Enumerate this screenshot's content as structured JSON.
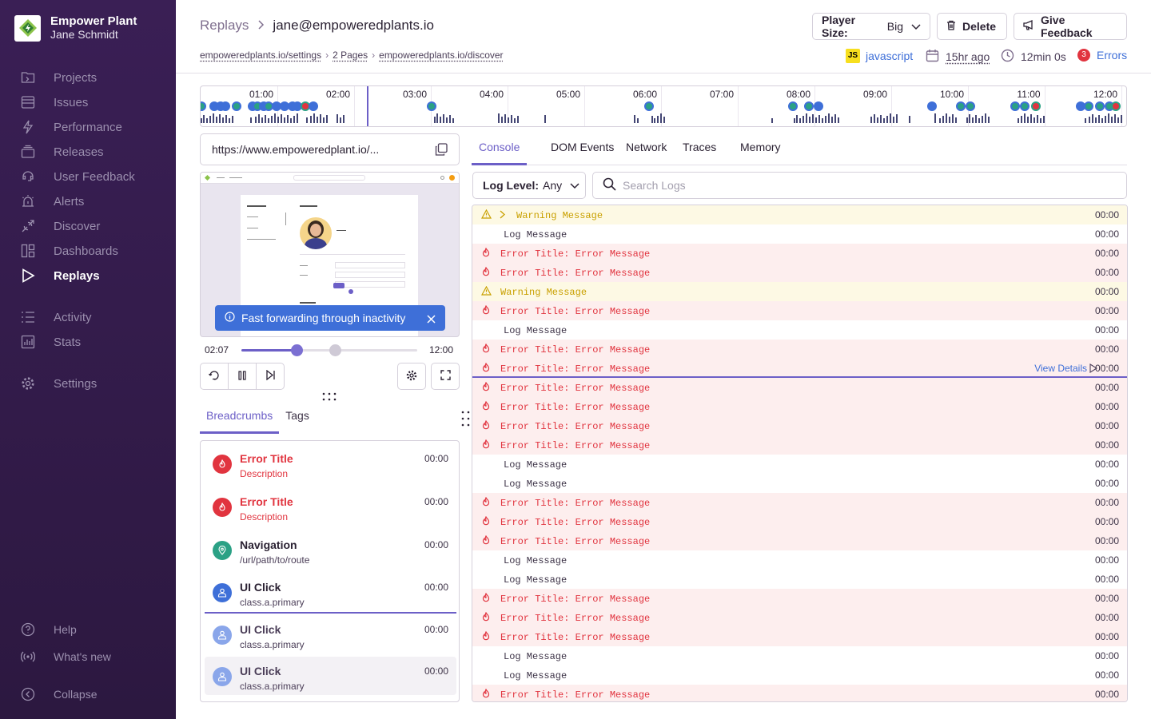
{
  "org": {
    "name": "Empower Plant",
    "user": "Jane Schmidt"
  },
  "sidebar": {
    "items": [
      {
        "label": "Projects",
        "icon": "projects-icon"
      },
      {
        "label": "Issues",
        "icon": "issues-icon"
      },
      {
        "label": "Performance",
        "icon": "performance-icon"
      },
      {
        "label": "Releases",
        "icon": "releases-icon"
      },
      {
        "label": "User Feedback",
        "icon": "user-feedback-icon"
      },
      {
        "label": "Alerts",
        "icon": "alerts-icon"
      },
      {
        "label": "Discover",
        "icon": "discover-icon"
      },
      {
        "label": "Dashboards",
        "icon": "dashboards-icon"
      },
      {
        "label": "Replays",
        "icon": "replays-icon",
        "active": true
      },
      {
        "label": "Activity",
        "icon": "activity-icon"
      },
      {
        "label": "Stats",
        "icon": "stats-icon"
      },
      {
        "label": "Settings",
        "icon": "settings-icon"
      }
    ],
    "footer": [
      {
        "label": "Help",
        "icon": "help-icon"
      },
      {
        "label": "What's new",
        "icon": "broadcast-icon"
      },
      {
        "label": "Collapse",
        "icon": "collapse-icon"
      }
    ]
  },
  "header": {
    "breadcrumb_parent": "Replays",
    "breadcrumb_current": "jane@empoweredplants.io",
    "url_trail": [
      "empoweredplants.io/settings",
      "2 Pages",
      "empoweredplants.io/discover"
    ],
    "player_size_label": "Player Size:",
    "player_size_value": "Big",
    "delete_label": "Delete",
    "feedback_label": "Give Feedback",
    "platform_badge": "JS",
    "platform": "javascript",
    "time_ago": "15hr ago",
    "duration": "12min 0s",
    "error_count": "3",
    "errors_label": "Errors"
  },
  "timeline": {
    "labels": [
      "01:00",
      "02:00",
      "03:00",
      "04:00",
      "05:00",
      "06:00",
      "07:00",
      "08:00",
      "09:00",
      "10:00",
      "11:00",
      "12:00"
    ]
  },
  "player": {
    "url": "https://www.empoweredplant.io/...",
    "toast": "Fast forwarding through inactivity",
    "current_time": "02:07",
    "total_time": "12:00",
    "progress": 0.18
  },
  "left_tabs": [
    "Breadcrumbs",
    "Tags"
  ],
  "breadcrumbs": [
    {
      "title": "Error Title",
      "desc": "Description",
      "time": "00:00",
      "kind": "error"
    },
    {
      "title": "Error Title",
      "desc": "Description",
      "time": "00:00",
      "kind": "error"
    },
    {
      "title": "Navigation",
      "desc": "/url/path/to/route",
      "time": "00:00",
      "kind": "nav"
    },
    {
      "title": "UI Click",
      "desc": "class.a.primary",
      "time": "00:00",
      "kind": "click"
    },
    {
      "title": "UI Click",
      "desc": "class.a.primary",
      "time": "00:00",
      "kind": "click-future"
    },
    {
      "title": "UI Click",
      "desc": "class.a.primary",
      "time": "00:00",
      "kind": "click-hover"
    }
  ],
  "right_tabs": [
    "Console",
    "DOM Events",
    "Network",
    "Traces",
    "Memory"
  ],
  "console": {
    "log_level_label": "Log Level:",
    "log_level_value": "Any",
    "search_placeholder": "Search Logs",
    "view_details": "View Details",
    "rows": [
      {
        "type": "warning",
        "text": "Warning Message",
        "time": "00:00",
        "expandable": true
      },
      {
        "type": "log",
        "text": "Log Message",
        "time": "00:00"
      },
      {
        "type": "error",
        "text": "Error Title: Error Message",
        "time": "00:00"
      },
      {
        "type": "error",
        "text": "Error Title: Error Message",
        "time": "00:00"
      },
      {
        "type": "warning",
        "text": "Warning Message",
        "time": "00:00"
      },
      {
        "type": "error",
        "text": "Error Title: Error Message",
        "time": "00:00"
      },
      {
        "type": "log",
        "text": "Log Message",
        "time": "00:00"
      },
      {
        "type": "error",
        "text": "Error Title: Error Message",
        "time": "00:00"
      },
      {
        "type": "error",
        "text": "Error Title: Error Message",
        "time": "00:00",
        "current": true
      },
      {
        "type": "error",
        "text": "Error Title: Error Message",
        "time": "00:00"
      },
      {
        "type": "error",
        "text": "Error Title: Error Message",
        "time": "00:00"
      },
      {
        "type": "error",
        "text": "Error Title: Error Message",
        "time": "00:00"
      },
      {
        "type": "error",
        "text": "Error Title: Error Message",
        "time": "00:00"
      },
      {
        "type": "log",
        "text": "Log Message",
        "time": "00:00"
      },
      {
        "type": "log",
        "text": "Log Message",
        "time": "00:00"
      },
      {
        "type": "error",
        "text": "Error Title: Error Message",
        "time": "00:00"
      },
      {
        "type": "error",
        "text": "Error Title: Error Message",
        "time": "00:00"
      },
      {
        "type": "error",
        "text": "Error Title: Error Message",
        "time": "00:00"
      },
      {
        "type": "log",
        "text": "Log Message",
        "time": "00:00"
      },
      {
        "type": "log",
        "text": "Log Message",
        "time": "00:00"
      },
      {
        "type": "error",
        "text": "Error Title: Error Message",
        "time": "00:00"
      },
      {
        "type": "error",
        "text": "Error Title: Error Message",
        "time": "00:00"
      },
      {
        "type": "error",
        "text": "Error Title: Error Message",
        "time": "00:00"
      },
      {
        "type": "log",
        "text": "Log Message",
        "time": "00:00"
      },
      {
        "type": "log",
        "text": "Log Message",
        "time": "00:00"
      },
      {
        "type": "error",
        "text": "Error Title: Error Message",
        "time": "00:00"
      }
    ]
  },
  "colors": {
    "accent": "#6c5fc7",
    "error": "#e1343f",
    "warning": "#c9a000",
    "nav": "#2ba185",
    "click": "#3e6fd8"
  }
}
